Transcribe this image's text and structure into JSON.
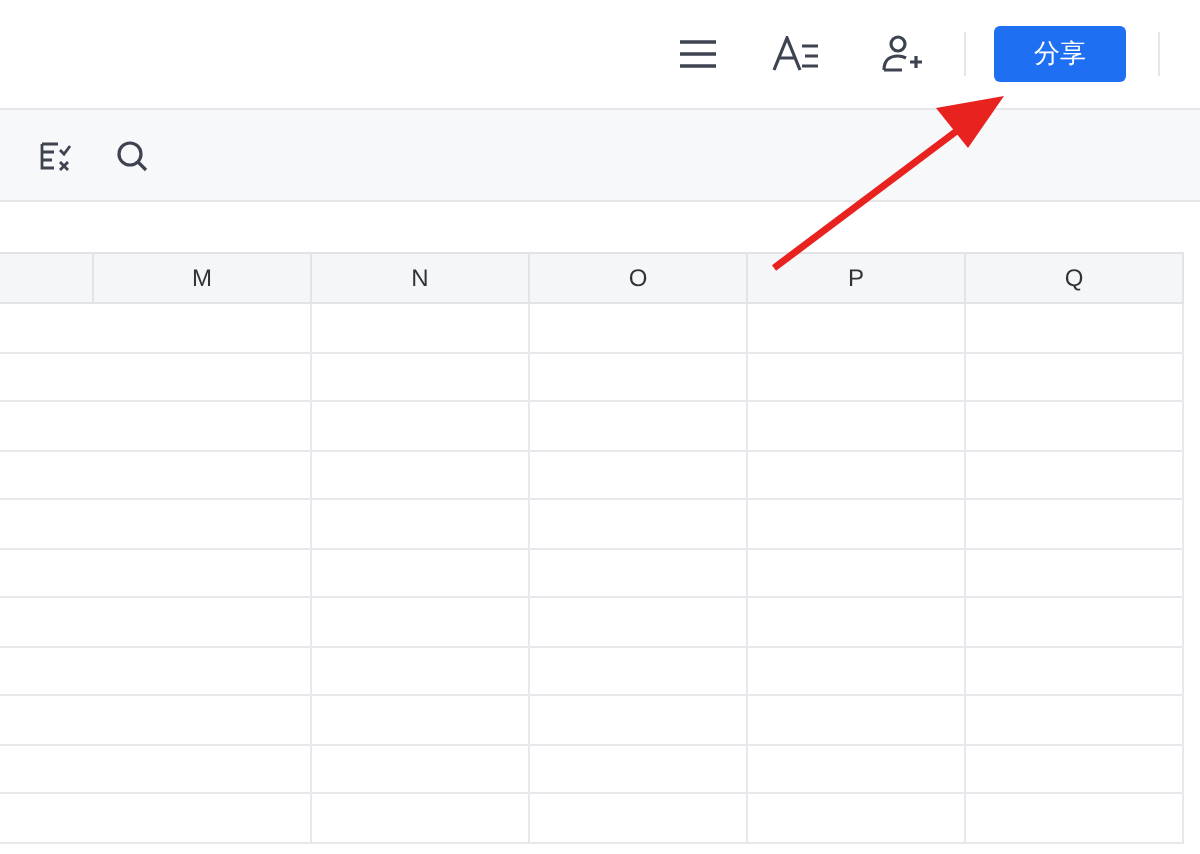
{
  "header": {
    "share_button": "分享"
  },
  "sheet": {
    "columns": [
      "M",
      "N",
      "O",
      "P",
      "Q"
    ]
  }
}
